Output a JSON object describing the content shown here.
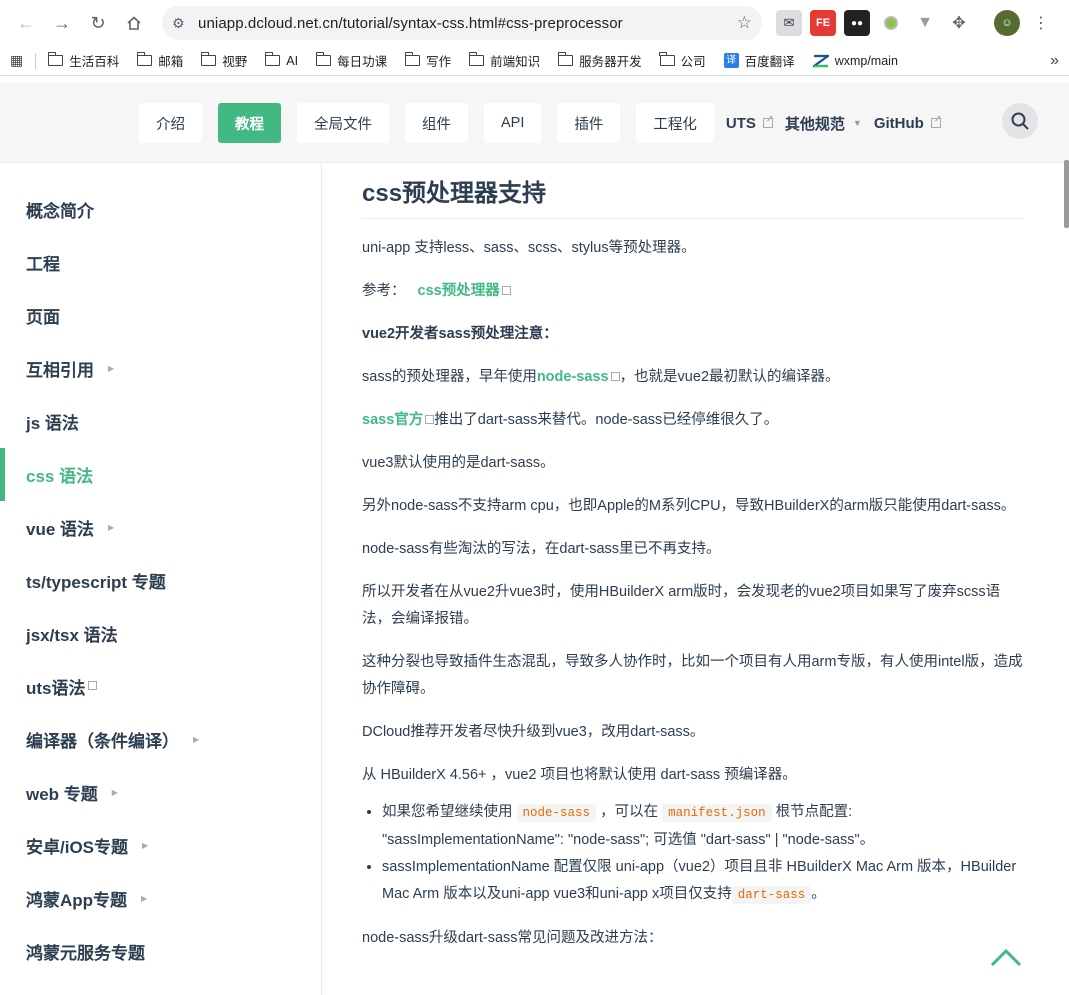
{
  "browser": {
    "url": "uniapp.dcloud.net.cn/tutorial/syntax-css.html#css-preprocessor",
    "bookmarks": [
      "生活百科",
      "邮箱",
      "视野",
      "AI",
      "每日功课",
      "写作",
      "前端知识",
      "服务器开发",
      "公司",
      "百度翻译",
      "wxmp/main"
    ]
  },
  "site_nav": {
    "buttons": [
      "介绍",
      "教程",
      "全局文件",
      "组件",
      "API",
      "插件",
      "工程化"
    ],
    "active": "教程",
    "text_links": {
      "uts": "UTS",
      "other": "其他规范",
      "github": "GitHub"
    }
  },
  "sidebar": {
    "items": [
      {
        "label": "概念简介",
        "arrow": false,
        "ext": false
      },
      {
        "label": "工程",
        "arrow": false,
        "ext": false
      },
      {
        "label": "页面",
        "arrow": false,
        "ext": false
      },
      {
        "label": "互相引用",
        "arrow": true,
        "ext": false
      },
      {
        "label": "js 语法",
        "arrow": false,
        "ext": false
      },
      {
        "label": "css 语法",
        "arrow": false,
        "ext": false,
        "active": true
      },
      {
        "label": "vue 语法",
        "arrow": true,
        "ext": false
      },
      {
        "label": "ts/typescript 专题",
        "arrow": false,
        "ext": false
      },
      {
        "label": "jsx/tsx 语法",
        "arrow": false,
        "ext": false
      },
      {
        "label": "uts语法",
        "arrow": false,
        "ext": true
      },
      {
        "label": "编译器（条件编译）",
        "arrow": true,
        "ext": false
      },
      {
        "label": "web 专题",
        "arrow": true,
        "ext": false
      },
      {
        "label": "安卓/iOS专题",
        "arrow": true,
        "ext": false
      },
      {
        "label": "鸿蒙App专题",
        "arrow": true,
        "ext": false
      },
      {
        "label": "鸿蒙元服务专题",
        "arrow": false,
        "ext": false
      }
    ]
  },
  "article": {
    "title": "css预处理器支持",
    "p1": "uni-app 支持less、sass、scss、stylus等预处理器。",
    "ref_label": "参考：",
    "ref_link": "css预处理器",
    "note_title": "vue2开发者sass预处理注意：",
    "p_sass_a": "sass的预处理器，早年使用",
    "p_sass_link": "node-sass",
    "p_sass_b": "，也就是vue2最初默认的编译器。",
    "p_official_link": "sass官方",
    "p_official_b": "推出了dart-sass来替代。node-sass已经停维很久了。",
    "p_vue3": "vue3默认使用的是dart-sass。",
    "p_arm": "另外node-sass不支持arm cpu，也即Apple的M系列CPU，导致HBuilderX的arm版只能使用dart-sass。",
    "p_deprecated": "node-sass有些淘汰的写法，在dart-sass里已不再支持。",
    "p_upgrade": "所以开发者在从vue2升vue3时，使用HBuilderX arm版时，会发现老的vue2项目如果写了废弃scss语法，会编译报错。",
    "p_split": "这种分裂也导致插件生态混乱，导致多人协作时，比如一个项目有人用arm专版，有人使用intel版，造成协作障碍。",
    "p_recommend": "DCloud推荐开发者尽快升级到vue3，改用dart-sass。",
    "p_hbx": "从 HBuilderX 4.56+ ，vue2 项目也将默认使用 dart-sass 预编译器。",
    "li1_a": "如果您希望继续使用",
    "li1_code1": "node-sass",
    "li1_b": "，可以在",
    "li1_code2": "manifest.json",
    "li1_c": "根节点配置: \"sassImplementationName\": \"node-sass\"; 可选值 \"dart-sass\" | \"node-sass\"。",
    "li2_a": "sassImplementationName 配置仅限 uni-app（vue2）项目且非 HBuilderX Mac Arm 版本，HBuilder Mac Arm 版本以及uni-app vue3和uni-app x项目仅支持",
    "li2_code": "dart-sass",
    "li2_b": "。",
    "p_faq": "node-sass升级dart-sass常见问题及改进方法："
  },
  "colors": {
    "accent": "#42b983",
    "text": "#2c3e50"
  }
}
